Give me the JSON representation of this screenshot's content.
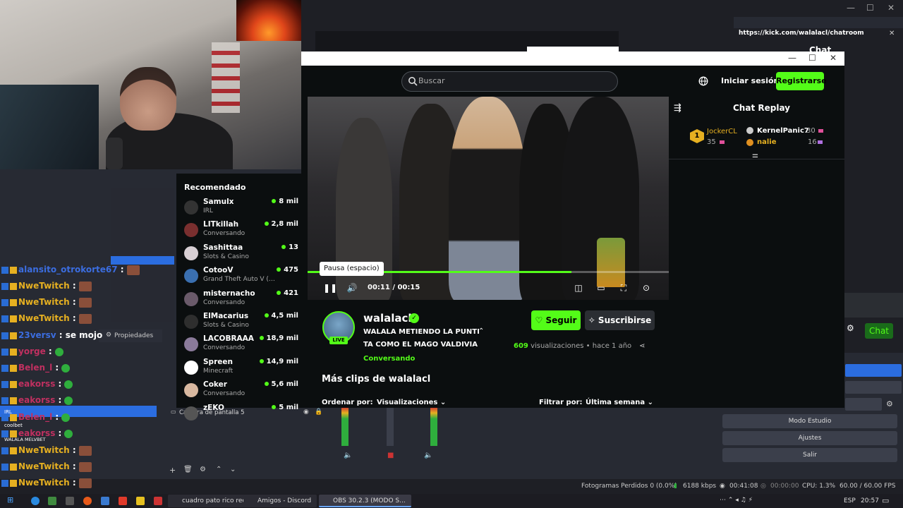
{
  "kick_popup": {
    "title": "https://kick.com/walalacl/chatroom",
    "chat_label": "Chat",
    "chat_button": "Chat"
  },
  "browser": {
    "search_placeholder": "Buscar",
    "login": "Iniciar sesión",
    "register": "Registrarse"
  },
  "sidebar": {
    "title": "Recomendado",
    "items": [
      {
        "name": "Samulx",
        "category": "IRL",
        "viewers": "8 mil"
      },
      {
        "name": "LITkillah",
        "category": "Conversando",
        "viewers": "2,8 mil"
      },
      {
        "name": "Sashittaa",
        "category": "Slots & Casino",
        "viewers": "13"
      },
      {
        "name": "CotooV",
        "category": "Grand Theft Auto V (G...",
        "viewers": "475"
      },
      {
        "name": "misternacho",
        "category": "Conversando",
        "viewers": "421"
      },
      {
        "name": "ElMacarius",
        "category": "Slots & Casino",
        "viewers": "4,5 mil"
      },
      {
        "name": "LACOBRAAA",
        "category": "Conversando",
        "viewers": "18,9 mil"
      },
      {
        "name": "Spreen",
        "category": "Minecraft",
        "viewers": "14,9 mil"
      },
      {
        "name": "Coker",
        "category": "Conversando",
        "viewers": "5,6 mil"
      },
      {
        "name": "zEKO",
        "category": "",
        "viewers": "5 mil"
      }
    ]
  },
  "player": {
    "tooltip": "Pausa (espacio)",
    "time": "00:11 / 00:15",
    "progress": 0.73
  },
  "replay": {
    "title": "Chat Replay",
    "leaders": [
      {
        "rank": "1",
        "name": "JockerCL",
        "count": "35"
      },
      {
        "name": "KernelPanic7",
        "count": "30"
      },
      {
        "name": "nalie",
        "count": "16"
      }
    ]
  },
  "clip": {
    "streamer": "walalacl",
    "live": "LIVE",
    "title_line1": "WALALA METIENDO LA PUNTI",
    "title_line2": "TA COMO EL MAGO VALDIVIA",
    "category": "Conversando",
    "follow": "Seguir",
    "subscribe": "Suscribirse",
    "views_count": "609",
    "views_label": "visualizaciones",
    "age": "• hace 1 año",
    "more_clips": "Más clips de walalacl",
    "sort_label": "Ordenar por:",
    "sort_value": "Visualizaciones",
    "filter_label": "Filtrar por:",
    "filter_value": "Última semana"
  },
  "left_chat": [
    {
      "user": "alansito_otrokorte67",
      "sep": " :",
      "color": "#3b6de0"
    },
    {
      "user": "NweTwitch",
      "sep": " :",
      "color": "#e6b021"
    },
    {
      "user": "NweTwitch",
      "sep": " :",
      "color": "#e6b021"
    },
    {
      "user": "NweTwitch",
      "sep": " :",
      "color": "#e6b021"
    },
    {
      "user": "23versv",
      "sep": " :",
      "msg": " se mojo",
      "color": "#3b6de0"
    },
    {
      "user": "yorge",
      "sep": " :",
      "color": "#c03060"
    },
    {
      "user": "Belen_l",
      "sep": " :",
      "color": "#c03060"
    },
    {
      "user": "eakorss",
      "sep": " :",
      "color": "#c03060"
    },
    {
      "user": "eakorss",
      "sep": " :",
      "color": "#c03060"
    },
    {
      "user": "Belen_l",
      "sep": " :",
      "color": "#c03060"
    },
    {
      "user": "eakorss",
      "sep": " :",
      "color": "#c03060"
    },
    {
      "user": "NweTwitch",
      "sep": " :",
      "color": "#e6b021"
    },
    {
      "user": "NweTwitch",
      "sep": " :",
      "color": "#e6b021"
    },
    {
      "user": "NweTwitch",
      "sep": " :",
      "color": "#e6b021"
    }
  ],
  "obs": {
    "properties": "Propiedades",
    "source": "Captura de pantalla 5",
    "studio_mode": "Modo Estudio",
    "settings": "Ajustes",
    "exit": "Salir",
    "frames_lost": "Fotogramas Perdidos 0 (0.0%)",
    "bitrate": "6188 kbps",
    "rec_time": "00:41:08",
    "stream_time": "00:00:00",
    "cpu": "CPU: 1.3%",
    "fps": "60.00 / 60.00 FPS",
    "mini_labels": [
      "IRL",
      "coolbet",
      "WALALA MELVBET"
    ]
  },
  "taskbar": {
    "apps": [
      "cuadro pato rico rect...",
      "Amigos - Discord",
      "OBS 30.2.3 (MODO S..."
    ],
    "lang": "ESP",
    "clock": "20:57"
  },
  "colors": {
    "kick_green": "#53fc18",
    "kick_bg": "#0b0e0f",
    "obs_bg": "#272a33"
  }
}
